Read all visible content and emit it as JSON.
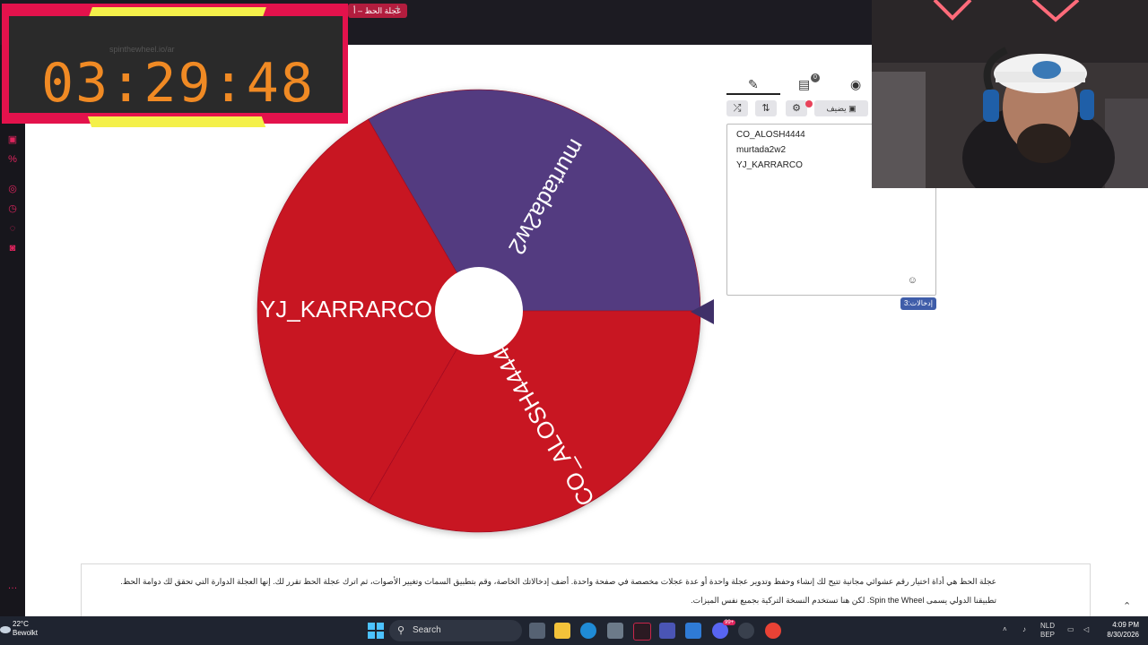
{
  "browser": {
    "tab_label": "عجلة الحظ – أ",
    "new_tab": "+"
  },
  "timer": {
    "url": "spinthewheel.io/ar",
    "time": "03:29:48"
  },
  "wheel": {
    "segments": [
      {
        "label": "murtada2w2",
        "color": "#533a80"
      },
      {
        "label": "CO_ALOSH4444",
        "color": "#c81224"
      },
      {
        "label": "YJ_KARRARCO",
        "color": "#c81224"
      }
    ],
    "pointer_color": "#3f3069"
  },
  "panel": {
    "tab_entries_icon": "pencil-icon",
    "tab_results_icon": "clipboard-icon",
    "tab_hide_icon": "eye-slash-icon",
    "results_count": "0",
    "add_label": "يضيف",
    "entries": [
      "CO_ALOSH4444",
      "murtada2w2",
      "YJ_KARRARCO"
    ],
    "entries_count_label": "إدخالات:3"
  },
  "info": {
    "line1": "عجلة الحظ هي أداة اختيار رقم عشوائي مجانية تتيح لك إنشاء وحفظ وتدوير عجلة واحدة أو عدة عجلات مخصصة في صفحة واحدة. أضف إدخالاتك الخاصة، وقم بتطبيق السمات وتغيير الأصوات، ثم اترك عجلة الحظ تقرر لك. إنها العجلة الدوارة التي تحقق لك دوامة الحظ.",
    "line2": "تطبيقنا الدولي يسمى Spin the Wheel. لكن هنا تستخدم النسخة التركية بجميع نفس الميزات."
  },
  "taskbar": {
    "temperature": "22°C",
    "weather": "Bewolkt",
    "search_placeholder": "Search",
    "lang_top": "NLD",
    "lang_bottom": "BEP",
    "time": "4:09 PM",
    "date": "8/30/2026",
    "discord_badge": "99+"
  }
}
